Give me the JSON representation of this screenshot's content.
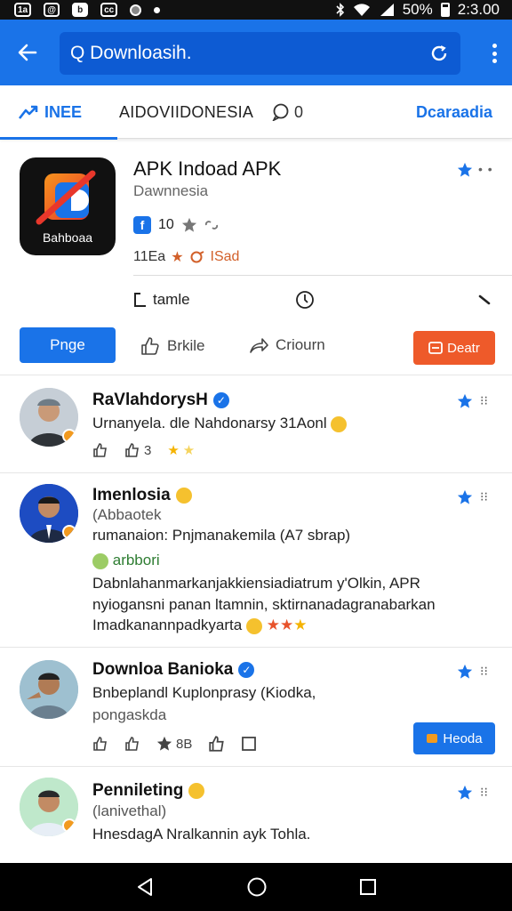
{
  "status_bar": {
    "icons_left": [
      "1a",
      "@",
      "b",
      "cc"
    ],
    "battery": "50%",
    "time": "2:3.00"
  },
  "app_bar": {
    "search_text": "Q Downloasih."
  },
  "tabs": [
    {
      "label": "INEE",
      "active": true
    },
    {
      "label": "AIDOVIIDONESIA",
      "active": false
    },
    {
      "label": "0",
      "active": false
    },
    {
      "label": "Dcaraadia",
      "active": false
    }
  ],
  "app": {
    "title": "APK Indoad APK",
    "subtitle": "Dawnnesia",
    "likes": "10",
    "size": "11Ea",
    "saved": "ISad",
    "row3_left": "tamle",
    "icon_label": "Bahboaa",
    "buttons": {
      "primary": "Pnge",
      "like": "Brkile",
      "share": "Criourn",
      "orange": "Deatr"
    }
  },
  "posts": [
    {
      "name": "RaVlahdorysH",
      "verified": true,
      "lines": [
        "Urnanyela. dle Nahdonarsy 31Aonl"
      ],
      "actions": {
        "count": "3"
      }
    },
    {
      "name": "Imenlosia",
      "verified": false,
      "lines": [
        "(Abbaotek",
        "rumanaion: Pnjmanakemila (A7 sbrap)",
        "arbbori",
        "Dabnlahanmarkanjakkiensiadiatrum y'Olkin, APR",
        "nyiogansni panan ltamnin, sktirnanadagranabarkan",
        "Imadkanannpadkyarta"
      ]
    },
    {
      "name": "Downloa Banioka",
      "verified": true,
      "lines": [
        "Bnbeplandl Kuplonprasy (Kiodka,",
        "pongaskda"
      ],
      "actions": {
        "rating": "8B"
      },
      "button": "Heoda"
    },
    {
      "name": "Pennileting",
      "verified": false,
      "lines": [
        "(lanivethal)",
        "HnesdagA Nralkannin ayk Tohla."
      ]
    }
  ],
  "colors": {
    "primary": "#1a73e8",
    "orange": "#ee5a2a"
  }
}
